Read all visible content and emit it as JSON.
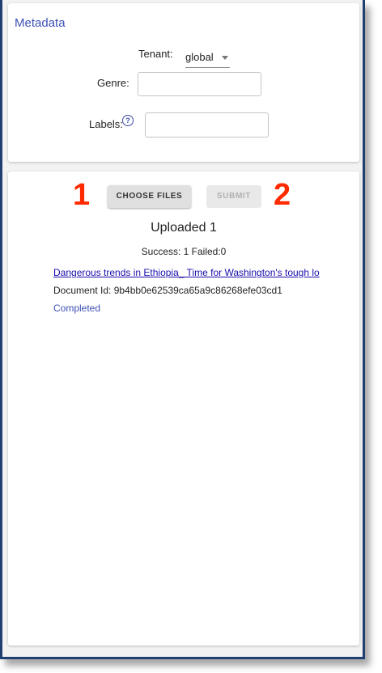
{
  "metadata": {
    "title": "Metadata",
    "tenant_label": "Tenant:",
    "tenant_value": "global",
    "genre_label": "Genre:",
    "genre_value": "",
    "labels_label": "Labels:",
    "labels_value": "",
    "help_icon": "?"
  },
  "upload": {
    "choose_files_label": "CHOOSE FILES",
    "submit_label": "SUBMIT",
    "marker_1": "1",
    "marker_2": "2",
    "uploaded_title": "Uploaded 1",
    "stats": "Success: 1 Failed:0",
    "document_link": "Dangerous trends in Ethiopia_ Time for Washington's tough lo",
    "document_id": "Document Id: 9b4bb0e62539ca65a9c86268efe03cd1",
    "status": "Completed"
  },
  "colors": {
    "accent": "#3f51b5",
    "link": "#1a0dab",
    "marker": "#ff2a00",
    "frame_border": "#1f3f73"
  }
}
